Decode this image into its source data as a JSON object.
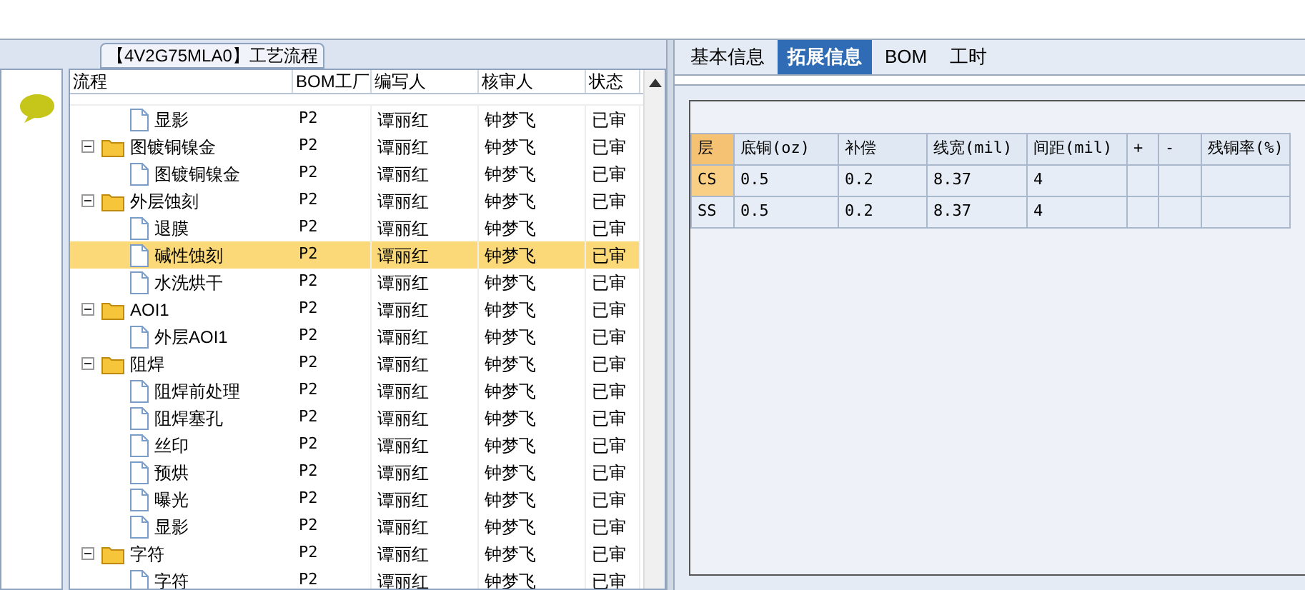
{
  "group_title": "【4V2G75MLA0】工艺流程",
  "flow_tree": {
    "columns": [
      "流程",
      "BOM工厂",
      "编写人",
      "核审人",
      "状态"
    ],
    "rows": [
      {
        "children": [
          {
            "kind": "file",
            "name": "显影",
            "bom_factory": "P2",
            "writer": "谭丽红",
            "reviewer": "钟梦飞",
            "status": "已审",
            "selected": false
          }
        ]
      },
      {
        "kind": "folder",
        "expanded": true,
        "name": "图镀铜镍金",
        "bom_factory": "P2",
        "writer": "谭丽红",
        "reviewer": "钟梦飞",
        "status": "已审",
        "selected": false,
        "children": [
          {
            "kind": "file",
            "name": "图镀铜镍金",
            "bom_factory": "P2",
            "writer": "谭丽红",
            "reviewer": "钟梦飞",
            "status": "已审",
            "selected": false
          }
        ]
      },
      {
        "kind": "folder",
        "expanded": true,
        "name": "外层蚀刻",
        "bom_factory": "P2",
        "writer": "谭丽红",
        "reviewer": "钟梦飞",
        "status": "已审",
        "selected": false,
        "children": [
          {
            "kind": "file",
            "name": "退膜",
            "bom_factory": "P2",
            "writer": "谭丽红",
            "reviewer": "钟梦飞",
            "status": "已审",
            "selected": false
          },
          {
            "kind": "file",
            "name": "碱性蚀刻",
            "bom_factory": "P2",
            "writer": "谭丽红",
            "reviewer": "钟梦飞",
            "status": "已审",
            "selected": true
          },
          {
            "kind": "file",
            "name": "水洗烘干",
            "bom_factory": "P2",
            "writer": "谭丽红",
            "reviewer": "钟梦飞",
            "status": "已审",
            "selected": false
          }
        ]
      },
      {
        "kind": "folder",
        "expanded": true,
        "name": "AOI1",
        "bom_factory": "P2",
        "writer": "谭丽红",
        "reviewer": "钟梦飞",
        "status": "已审",
        "selected": false,
        "children": [
          {
            "kind": "file",
            "name": "外层AOI1",
            "bom_factory": "P2",
            "writer": "谭丽红",
            "reviewer": "钟梦飞",
            "status": "已审",
            "selected": false
          }
        ]
      },
      {
        "kind": "folder",
        "expanded": true,
        "name": "阻焊",
        "bom_factory": "P2",
        "writer": "谭丽红",
        "reviewer": "钟梦飞",
        "status": "已审",
        "selected": false,
        "children": [
          {
            "kind": "file",
            "name": "阻焊前处理",
            "bom_factory": "P2",
            "writer": "谭丽红",
            "reviewer": "钟梦飞",
            "status": "已审",
            "selected": false
          },
          {
            "kind": "file",
            "name": "阻焊塞孔",
            "bom_factory": "P2",
            "writer": "谭丽红",
            "reviewer": "钟梦飞",
            "status": "已审",
            "selected": false
          },
          {
            "kind": "file",
            "name": "丝印",
            "bom_factory": "P2",
            "writer": "谭丽红",
            "reviewer": "钟梦飞",
            "status": "已审",
            "selected": false
          },
          {
            "kind": "file",
            "name": "预烘",
            "bom_factory": "P2",
            "writer": "谭丽红",
            "reviewer": "钟梦飞",
            "status": "已审",
            "selected": false
          },
          {
            "kind": "file",
            "name": "曝光",
            "bom_factory": "P2",
            "writer": "谭丽红",
            "reviewer": "钟梦飞",
            "status": "已审",
            "selected": false
          },
          {
            "kind": "file",
            "name": "显影",
            "bom_factory": "P2",
            "writer": "谭丽红",
            "reviewer": "钟梦飞",
            "status": "已审",
            "selected": false
          }
        ]
      },
      {
        "kind": "folder",
        "expanded": true,
        "name": "字符",
        "bom_factory": "P2",
        "writer": "谭丽红",
        "reviewer": "钟梦飞",
        "status": "已审",
        "selected": false,
        "children": [
          {
            "kind": "file",
            "name": "字符",
            "bom_factory": "P2",
            "writer": "谭丽红",
            "reviewer": "钟梦飞",
            "status": "已审",
            "selected": false
          }
        ]
      }
    ]
  },
  "tabs": [
    {
      "label": "基本信息",
      "selected": false
    },
    {
      "label": "拓展信息",
      "selected": true
    },
    {
      "label": "BOM",
      "selected": false
    },
    {
      "label": "工时",
      "selected": false
    }
  ],
  "layer_table": {
    "columns": [
      "层",
      "底铜(oz)",
      "补偿",
      "线宽(mil)",
      "间距(mil)",
      "+",
      "-",
      "残铜率(%)"
    ],
    "rows": [
      {
        "selected": true,
        "cells": [
          "CS",
          "0.5",
          "0.2",
          "8.37",
          "4",
          "",
          "",
          ""
        ]
      },
      {
        "selected": false,
        "cells": [
          "SS",
          "0.5",
          "0.2",
          "8.37",
          "4",
          "",
          "",
          ""
        ]
      }
    ]
  }
}
